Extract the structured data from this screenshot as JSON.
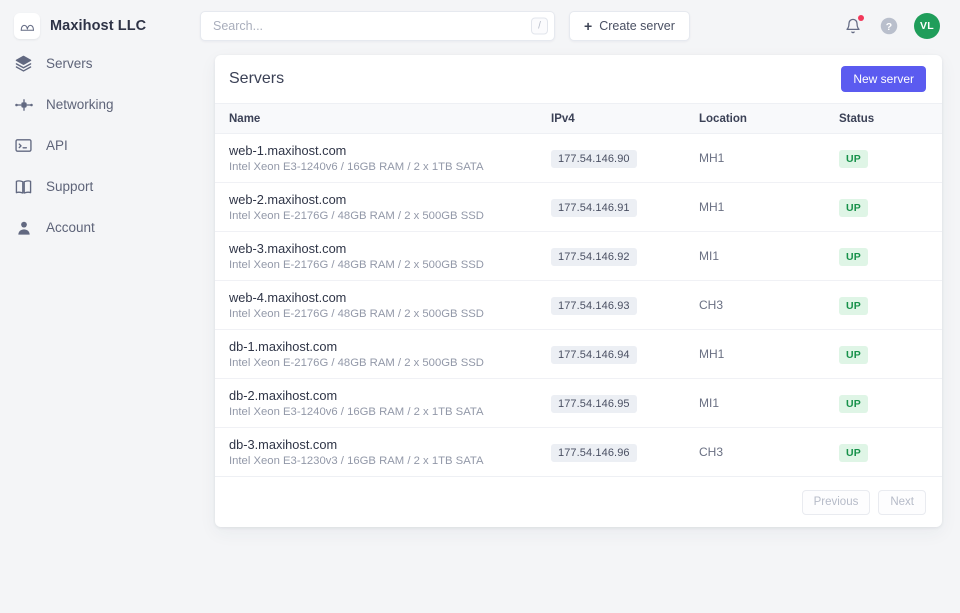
{
  "topbar": {
    "brand_name": "Maxihost LLC",
    "logo_icon": "mountain-infinity-logo",
    "search": {
      "value": "",
      "placeholder": "Search...",
      "shortcut_key": "/"
    },
    "create_button": {
      "label": "Create server",
      "plus": "+"
    },
    "notifications_icon": "bell-icon",
    "has_notification": true,
    "help_icon": "question-circle-icon",
    "avatar_initials": "VL",
    "avatar_color": "#1f9d5a"
  },
  "sidebar": {
    "items": [
      {
        "label": "Servers",
        "icon": "layers-icon"
      },
      {
        "label": "Networking",
        "icon": "network-nodes-icon"
      },
      {
        "label": "API",
        "icon": "terminal-icon"
      },
      {
        "label": "Support",
        "icon": "book-icon"
      },
      {
        "label": "Account",
        "icon": "user-icon"
      }
    ]
  },
  "card": {
    "title": "Servers",
    "new_server_label": "New server",
    "accent_color": "#5b5bf0",
    "columns": [
      "Name",
      "IPv4",
      "Location",
      "Status"
    ],
    "rows": [
      {
        "name": "web-1.maxihost.com",
        "spec": "Intel Xeon E3-1240v6 / 16GB RAM / 2 x 1TB SATA",
        "ipv4": "177.54.146.90",
        "location": "MH1",
        "status": "UP"
      },
      {
        "name": "web-2.maxihost.com",
        "spec": "Intel Xeon E-2176G / 48GB RAM / 2 x 500GB SSD",
        "ipv4": "177.54.146.91",
        "location": "MH1",
        "status": "UP"
      },
      {
        "name": "web-3.maxihost.com",
        "spec": "Intel Xeon E-2176G / 48GB RAM / 2 x 500GB SSD",
        "ipv4": "177.54.146.92",
        "location": "MI1",
        "status": "UP"
      },
      {
        "name": "web-4.maxihost.com",
        "spec": "Intel Xeon E-2176G / 48GB RAM / 2 x 500GB SSD",
        "ipv4": "177.54.146.93",
        "location": "CH3",
        "status": "UP"
      },
      {
        "name": "db-1.maxihost.com",
        "spec": "Intel Xeon E-2176G / 48GB RAM / 2 x 500GB SSD",
        "ipv4": "177.54.146.94",
        "location": "MH1",
        "status": "UP"
      },
      {
        "name": "db-2.maxihost.com",
        "spec": "Intel Xeon E3-1240v6 / 16GB RAM / 2 x 1TB SATA",
        "ipv4": "177.54.146.95",
        "location": "MI1",
        "status": "UP"
      },
      {
        "name": "db-3.maxihost.com",
        "spec": "Intel Xeon E3-1230v3 / 16GB RAM / 2 x 1TB SATA",
        "ipv4": "177.54.146.96",
        "location": "CH3",
        "status": "UP"
      }
    ],
    "pagination": {
      "previous_label": "Previous",
      "next_label": "Next",
      "previous_disabled": true,
      "next_disabled": true
    }
  }
}
